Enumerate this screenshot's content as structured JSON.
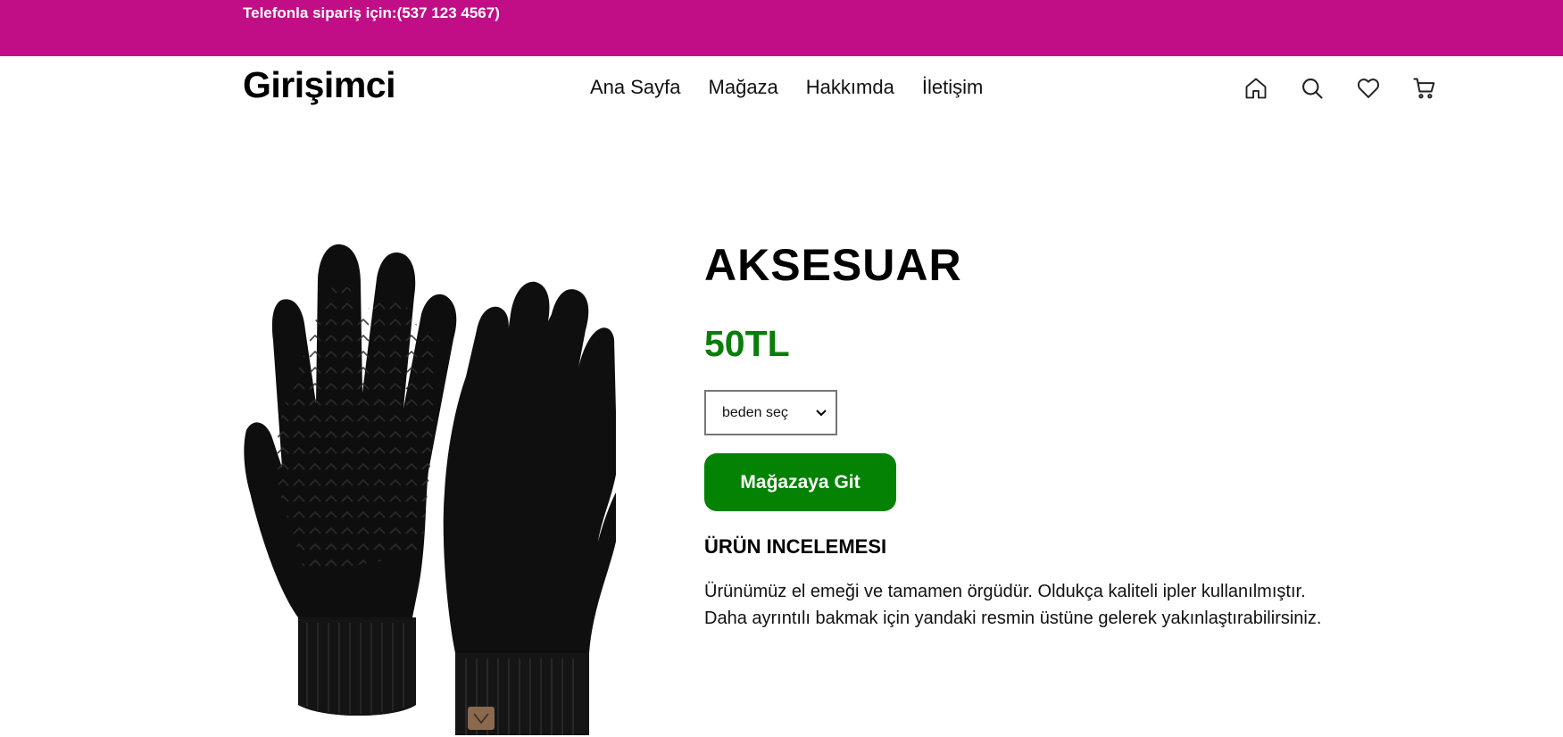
{
  "topbar": {
    "phone_text": "Telefonla sipariş için:(537 123 4567)",
    "background_color": "#c10e87"
  },
  "header": {
    "logo": "Girişimci",
    "nav": [
      {
        "label": "Ana Sayfa"
      },
      {
        "label": "Mağaza"
      },
      {
        "label": "Hakkımda"
      },
      {
        "label": "İletişim"
      }
    ],
    "icons": [
      "home-icon",
      "search-icon",
      "heart-icon",
      "cart-icon"
    ]
  },
  "product": {
    "title": "AKSESUAR",
    "price": "50TL",
    "price_color": "#0a7d0a",
    "size_select": {
      "selected": "beden seç"
    },
    "store_button_label": "Mağazaya Git",
    "button_color": "#038203",
    "review_heading": "ÜRÜN INCELEMESI",
    "review_lines": [
      "Ürünümüz el emeği ve tamamen örgüdür. Oldukça kaliteli ipler kullanılmıştır.",
      "Daha ayrıntılı bakmak için yandaki resmin üstüne gelerek yakınlaştırabilirsiniz."
    ],
    "image_subject": "black knit gloves"
  }
}
